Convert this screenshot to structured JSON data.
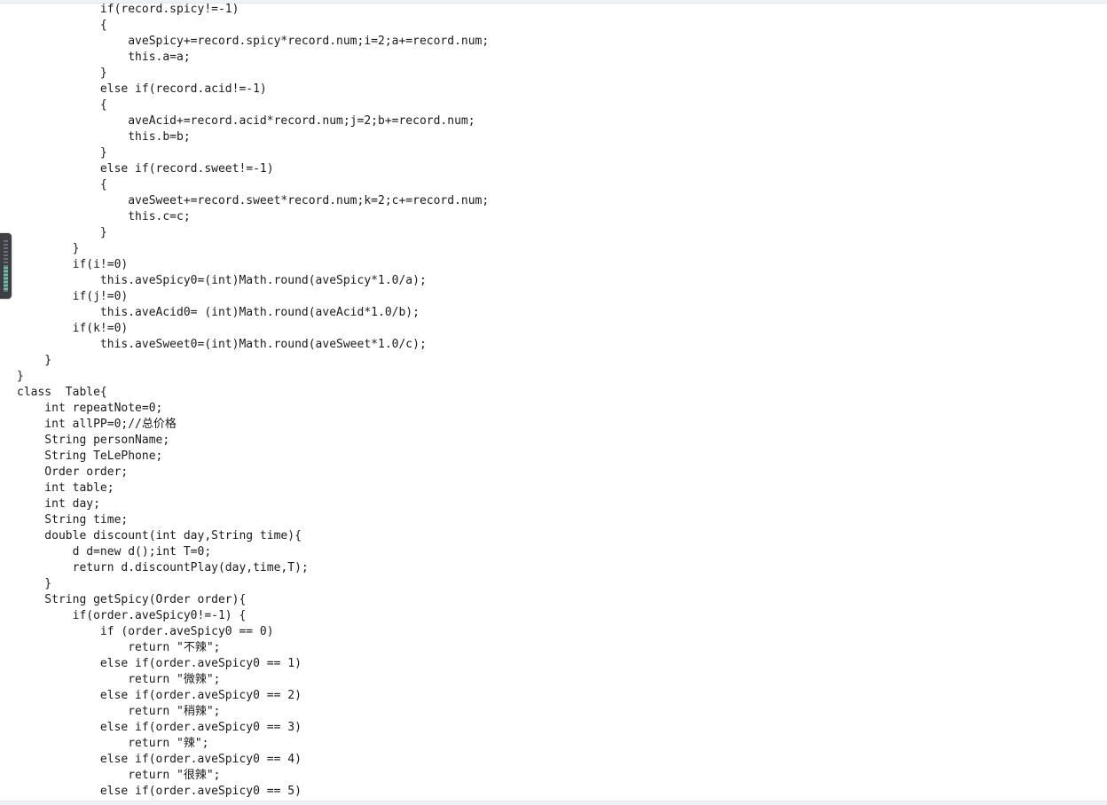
{
  "code": {
    "lines": [
      "            if(record.spicy!=-1)",
      "            {",
      "                aveSpicy+=record.spicy*record.num;i=2;a+=record.num;",
      "                this.a=a;",
      "            }",
      "            else if(record.acid!=-1)",
      "            {",
      "                aveAcid+=record.acid*record.num;j=2;b+=record.num;",
      "                this.b=b;",
      "            }",
      "            else if(record.sweet!=-1)",
      "            {",
      "                aveSweet+=record.sweet*record.num;k=2;c+=record.num;",
      "                this.c=c;",
      "            }",
      "        }",
      "        if(i!=0)",
      "            this.aveSpicy0=(int)Math.round(aveSpicy*1.0/a);",
      "        if(j!=0)",
      "            this.aveAcid0= (int)Math.round(aveAcid*1.0/b);",
      "        if(k!=0)",
      "            this.aveSweet0=(int)Math.round(aveSweet*1.0/c);",
      "    }",
      "}",
      "class  Table{",
      "    int repeatNote=0;",
      "    int allPP=0;//总价格",
      "    String personName;",
      "    String TeLePhone;",
      "    Order order;",
      "    int table;",
      "    int day;",
      "    String time;",
      "    double discount(int day,String time){",
      "        d d=new d();int T=0;",
      "        return d.discountPlay(day,time,T);",
      "    }",
      "    String getSpicy(Order order){",
      "        if(order.aveSpicy0!=-1) {",
      "            if (order.aveSpicy0 == 0)",
      "                return \"不辣\";",
      "            else if(order.aveSpicy0 == 1)",
      "                return \"微辣\";",
      "            else if(order.aveSpicy0 == 2)",
      "                return \"稍辣\";",
      "            else if(order.aveSpicy0 == 3)",
      "                return \"辣\";",
      "            else if(order.aveSpicy0 == 4)",
      "                return \"很辣\";",
      "            else if(order.aveSpicy0 == 5)"
    ]
  },
  "side_widget": {
    "icon": "audio-level-meter-icon",
    "level_fraction": 0.48
  },
  "colors": {
    "text": "#1a1a1a",
    "background": "#ffffff",
    "widget": "#3d3f44",
    "meter_active": "#59c9a5"
  }
}
